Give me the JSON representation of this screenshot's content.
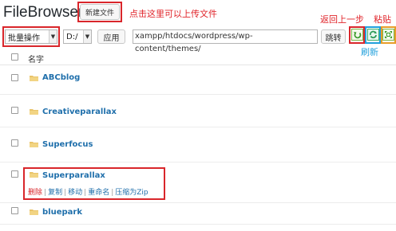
{
  "header": {
    "title": "FileBrowser",
    "new_file_label": "新建文件",
    "upload_hint": "点击这里可以上传文件"
  },
  "toolbar": {
    "bulk_action_value": "批量操作",
    "drive_value": "D:/",
    "apply_label": "应用",
    "path_value": "xampp/htdocs/wordpress/wp-content/themes/",
    "go_label": "跳转",
    "back_hint": "返回上一步",
    "paste_hint": "粘贴",
    "refresh_hint": "刷新"
  },
  "table": {
    "name_header": "名字",
    "rows": [
      {
        "name": "ABCblog"
      },
      {
        "name": "Creativeparallax"
      },
      {
        "name": "Superfocus"
      },
      {
        "name": "Superparallax"
      },
      {
        "name": "bluepark"
      }
    ],
    "row_actions": [
      "删除",
      "复制",
      "移动",
      "重命名",
      "压缩为Zip"
    ]
  },
  "colors": {
    "annotation_red": "#e0242a",
    "annotation_blue": "#22a0dc",
    "link_blue": "#1f6fab",
    "folder_yellow": "#e9c46a"
  },
  "icons": {
    "back": "back-arrow-icon",
    "refresh": "refresh-icon",
    "paste": "expand-icon",
    "folder": "folder-icon"
  }
}
